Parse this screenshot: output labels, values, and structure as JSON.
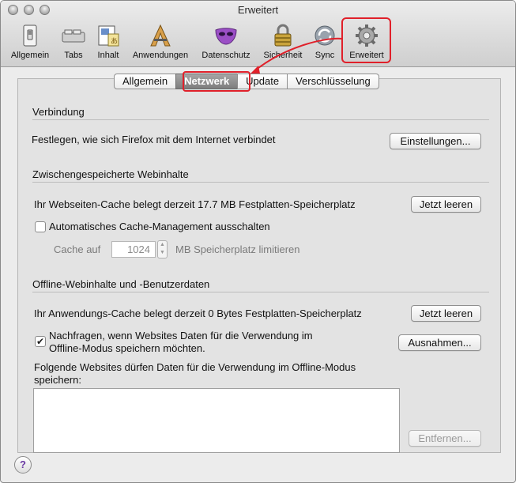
{
  "window": {
    "title": "Erweitert"
  },
  "toolbar": {
    "items": [
      {
        "label": "Allgemein",
        "icon": "light-switch-icon"
      },
      {
        "label": "Tabs",
        "icon": "tabs-icon"
      },
      {
        "label": "Inhalt",
        "icon": "content-icon"
      },
      {
        "label": "Anwendungen",
        "icon": "applications-icon"
      },
      {
        "label": "Datenschutz",
        "icon": "privacy-mask-icon"
      },
      {
        "label": "Sicherheit",
        "icon": "padlock-icon"
      },
      {
        "label": "Sync",
        "icon": "sync-icon"
      },
      {
        "label": "Erweitert",
        "icon": "gear-icon"
      }
    ]
  },
  "tabs": {
    "items": [
      {
        "label": "Allgemein",
        "active": false
      },
      {
        "label": "Netzwerk",
        "active": true
      },
      {
        "label": "Update",
        "active": false
      },
      {
        "label": "Verschlüsselung",
        "active": false
      }
    ]
  },
  "verbindung": {
    "title": "Verbindung",
    "description": "Festlegen, wie sich Firefox mit dem Internet verbindet",
    "settings_button": "Einstellungen..."
  },
  "cache": {
    "title": "Zwischengespeicherte Webinhalte",
    "usage_text": "Ihr Webseiten-Cache belegt derzeit 17.7 MB Festplatten-Speicherplatz",
    "clear_button": "Jetzt leeren",
    "override_label": "Automatisches Cache-Management ausschalten",
    "override_checked": false,
    "limit_prefix": "Cache auf",
    "limit_value": "1024",
    "limit_suffix": "MB Speicherplatz limitieren"
  },
  "offline": {
    "title": "Offline-Webinhalte und -Benutzerdaten",
    "usage_text": "Ihr Anwendungs-Cache belegt derzeit 0 Bytes Festplatten-Speicherplatz",
    "clear_button": "Jetzt leeren",
    "ask_label_line1": "Nachfragen, wenn Websites Daten für die Verwendung im",
    "ask_label_line2": "Offline-Modus speichern möchten.",
    "ask_checked": true,
    "exceptions_button": "Ausnahmen...",
    "allowed_label_line1": "Folgende Websites dürfen Daten für die Verwendung im Offline-Modus",
    "allowed_label_line2": "speichern:",
    "remove_button": "Entfernen..."
  },
  "help": {
    "label": "?"
  },
  "colors": {
    "highlight": "#e0202a",
    "active_tab": "#7d7d7d"
  }
}
